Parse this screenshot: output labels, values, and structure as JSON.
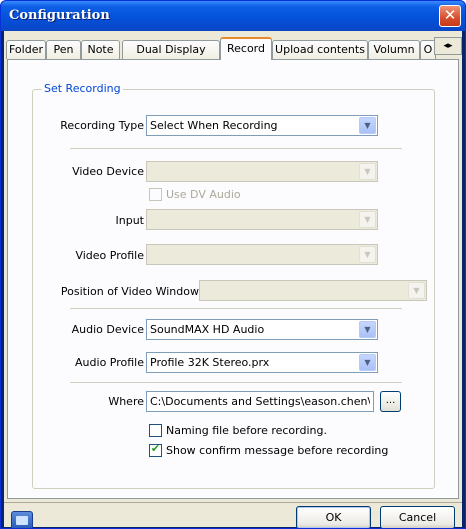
{
  "window": {
    "title": "Configuration",
    "close_glyph": "✕"
  },
  "tabs": [
    {
      "label": "Folder"
    },
    {
      "label": "Pen"
    },
    {
      "label": "Note"
    },
    {
      "label": "Dual Display"
    },
    {
      "label": "Record"
    },
    {
      "label": "Upload contents"
    },
    {
      "label": "Volumn"
    },
    {
      "label": "O"
    }
  ],
  "tab_scroll": {
    "left": "◂",
    "right": "▸"
  },
  "group": {
    "label": "Set Recording"
  },
  "form": {
    "recording_type_label": "Recording Type",
    "recording_type_value": "Select When Recording",
    "video_device_label": "Video Device",
    "video_device_value": "",
    "use_dv_audio_label": "Use DV Audio",
    "input_label": "Input",
    "input_value": "",
    "video_profile_label": "Video Profile",
    "video_profile_value": "",
    "position_label": "Position of Video Window",
    "position_value": "",
    "audio_device_label": "Audio Device",
    "audio_device_value": "SoundMAX HD Audio",
    "audio_profile_label": "Audio Profile",
    "audio_profile_value": "Profile 32K Stereo.prx",
    "where_label": "Where",
    "where_value": "C:\\Documents and Settings\\eason.chen\\My",
    "browse_label": "...",
    "naming_file_label": "Naming file before recording.",
    "naming_file_checked": false,
    "show_confirm_label": "Show confirm message before recording",
    "show_confirm_checked": true
  },
  "dropdown_glyph": "▼",
  "check_glyph": "✔",
  "buttons": {
    "ok": "OK",
    "cancel": "Cancel"
  }
}
